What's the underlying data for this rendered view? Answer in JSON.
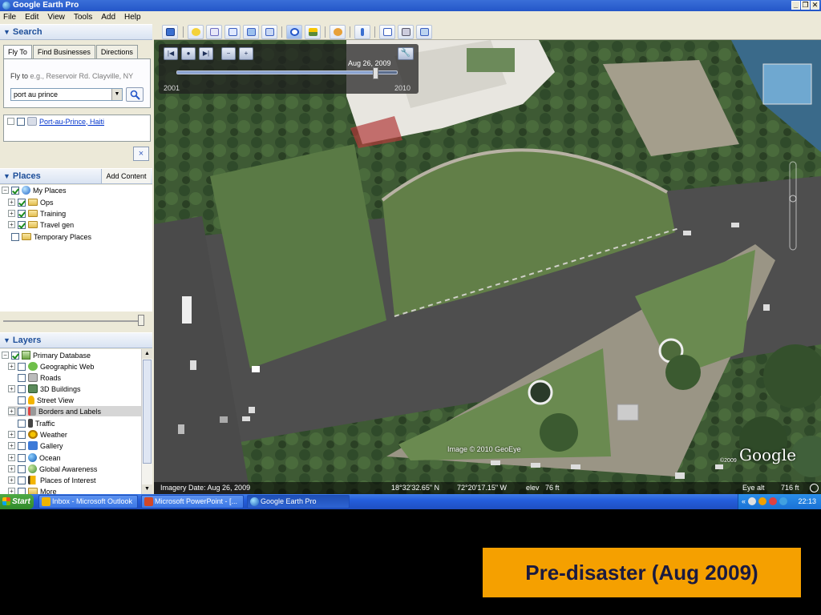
{
  "window": {
    "title": "Google Earth Pro",
    "controls": [
      "_",
      "❐",
      "✕"
    ]
  },
  "menu": [
    "File",
    "Edit",
    "View",
    "Tools",
    "Add",
    "Help"
  ],
  "search": {
    "header": "Search",
    "tabs": [
      "Fly To",
      "Find Businesses",
      "Directions"
    ],
    "flyto_label": "Fly to",
    "flyto_hint": "e.g., Reservoir Rd. Clayville, NY",
    "flyto_value": "port au prince",
    "result": "Port-au-Prince, Haiti",
    "clear_symbol": "×"
  },
  "places": {
    "header": "Places",
    "add_content": "Add Content",
    "items": [
      "My Places",
      "Ops",
      "Training",
      "Travel gen",
      "Temporary Places"
    ]
  },
  "layers": {
    "header": "Layers",
    "items": [
      "Primary Database",
      "Geographic Web",
      "Roads",
      "3D Buildings",
      "Street View",
      "Borders and Labels",
      "Traffic",
      "Weather",
      "Gallery",
      "Ocean",
      "Global Awareness",
      "Places of Interest",
      "More"
    ]
  },
  "time_slider": {
    "date": "Aug 26, 2009",
    "start": "2001",
    "end": "2010",
    "position": 0.9
  },
  "map": {
    "copyright": "Image © 2010 GeoEye",
    "logo_year": "©2009",
    "logo": "Google",
    "imagery_date": "Imagery Date: Aug 26, 2009",
    "lat": "18°32'32.65\" N",
    "lon": "72°20'17.15\" W",
    "elev_label": "elev",
    "elev_value": "76 ft",
    "eye_label": "Eye alt",
    "eye_value": "716 ft"
  },
  "taskbar": {
    "start": "Start",
    "tasks": [
      "Inbox - Microsoft Outlook",
      "Microsoft PowerPoint - [...",
      "Google Earth Pro"
    ],
    "tray_chevron": "«",
    "clock": "22:13"
  },
  "caption": "Pre-disaster (Aug 2009)",
  "colors": {
    "caption_bg": "#f5a000",
    "title_bar": "#2456c8",
    "start_button": "#2f8a2a"
  }
}
